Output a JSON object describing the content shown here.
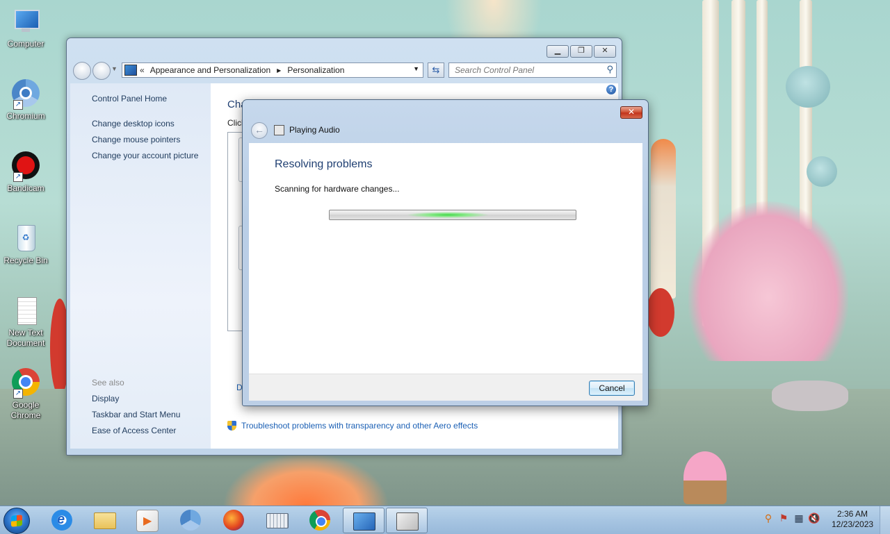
{
  "desktop_icons": [
    {
      "label": "Computer"
    },
    {
      "label": "Chromium"
    },
    {
      "label": "Bandicam"
    },
    {
      "label": "Recycle Bin"
    },
    {
      "label": "New Text Document"
    },
    {
      "label": "Google Chrome"
    }
  ],
  "control_panel": {
    "breadcrumb_sep": "«",
    "breadcrumb": [
      "Appearance and Personalization",
      "Personalization"
    ],
    "search_placeholder": "Search Control Panel",
    "left_links": [
      "Control Panel Home",
      "Change desktop icons",
      "Change mouse pointers",
      "Change your account picture"
    ],
    "see_also_label": "See also",
    "see_also_links": [
      "Display",
      "Taskbar and Start Menu",
      "Ease of Access Center"
    ],
    "heading_partial": "Cha",
    "subtext_partial": "Click",
    "link_partial": "D",
    "troubleshoot_link": "Troubleshoot problems with transparency and other Aero effects"
  },
  "dialog": {
    "title": "Playing Audio",
    "heading": "Resolving problems",
    "status": "Scanning for hardware changes...",
    "cancel_label": "Cancel"
  },
  "taskbar": {
    "items": [
      "internet-explorer",
      "windows-explorer",
      "media-player",
      "chromium",
      "firefox",
      "on-screen-keyboard",
      "google-chrome",
      "control-panel",
      "troubleshooter"
    ],
    "time": "2:36 AM",
    "date": "12/23/2023"
  }
}
